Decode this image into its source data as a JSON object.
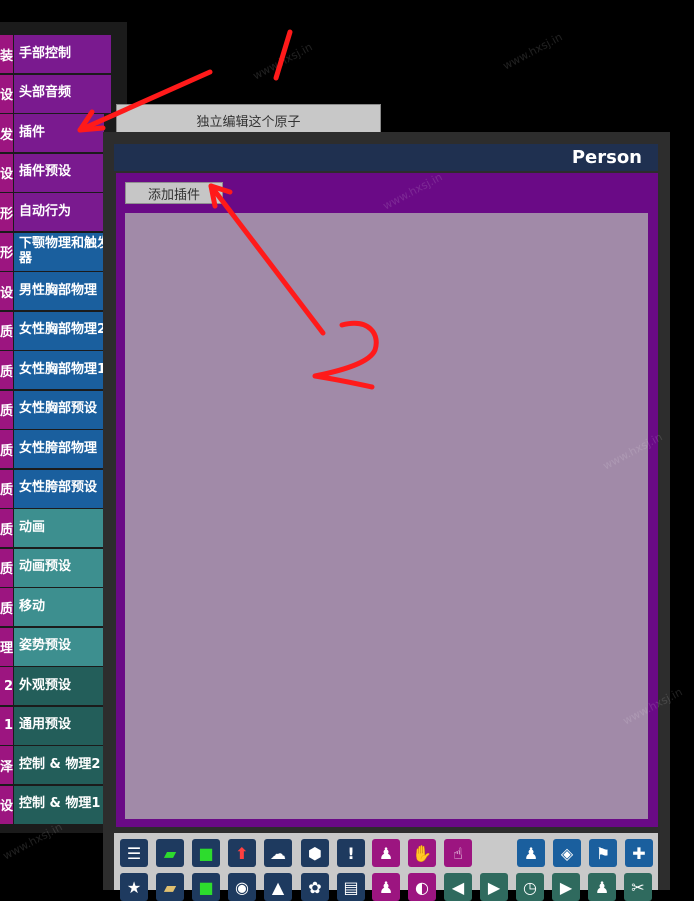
{
  "sidebar": {
    "tabs": [
      {
        "left": "装",
        "label": "手部控制",
        "left_color": "#9c1580",
        "color": "#7a1a8f"
      },
      {
        "left": "设",
        "label": "头部音频",
        "left_color": "#9c1580",
        "color": "#7a1a8f"
      },
      {
        "left": "发",
        "label": "插件",
        "left_color": "#9c1580",
        "color": "#7a1a8f",
        "active": true
      },
      {
        "left": "设",
        "label": "插件预设",
        "left_color": "#9c1580",
        "color": "#7a1a8f"
      },
      {
        "left": "形",
        "label": "自动行为",
        "left_color": "#9c1580",
        "color": "#7a1a8f"
      },
      {
        "left": "形",
        "label": "下颚物理和触发器",
        "left_color": "#9c1580",
        "color": "#1a5f9e"
      },
      {
        "left": "设",
        "label": "男性胸部物理",
        "left_color": "#9c1580",
        "color": "#1a5f9e"
      },
      {
        "left": "质",
        "label": "女性胸部物理2",
        "left_color": "#9c1580",
        "color": "#1a5f9e"
      },
      {
        "left": "质",
        "label": "女性胸部物理1",
        "left_color": "#9c1580",
        "color": "#1a5f9e"
      },
      {
        "left": "质",
        "label": "女性胸部预设",
        "left_color": "#9c1580",
        "color": "#1a5f9e"
      },
      {
        "left": "质",
        "label": "女性胯部物理",
        "left_color": "#9c1580",
        "color": "#1a5f9e"
      },
      {
        "left": "质",
        "label": "女性胯部预设",
        "left_color": "#9c1580",
        "color": "#1a5f9e"
      },
      {
        "left": "质",
        "label": "动画",
        "left_color": "#9c1580",
        "color": "#3d8f8f"
      },
      {
        "left": "质",
        "label": "动画预设",
        "left_color": "#9c1580",
        "color": "#3d8f8f"
      },
      {
        "left": "质",
        "label": "移动",
        "left_color": "#9c1580",
        "color": "#3d8f8f"
      },
      {
        "left": "理",
        "label": "姿势预设",
        "left_color": "#9c1580",
        "color": "#3d8f8f"
      },
      {
        "left": "2",
        "label": "外观预设",
        "left_color": "#9c1580",
        "color": "#235e5a"
      },
      {
        "left": "1",
        "label": "通用预设",
        "left_color": "#9c1580",
        "color": "#235e5a"
      },
      {
        "left": "泽",
        "label": "控制 & 物理2",
        "left_color": "#9c1580",
        "color": "#235e5a"
      },
      {
        "left": "设",
        "label": "控制 & 物理1",
        "left_color": "#9c1580",
        "color": "#235e5a"
      }
    ]
  },
  "tooltip": {
    "text": "独立编辑这个原子"
  },
  "panel": {
    "title": "Person",
    "add_plugin_label": "添加插件"
  },
  "annotations": {
    "label_1": "1",
    "label_2": "2",
    "color": "#ff1a1a"
  },
  "watermark": {
    "text": "www.hxsj.in"
  },
  "toolbar": {
    "row1": [
      {
        "icon": "menu-icon",
        "glyph": "☰",
        "bg": "#1e3a5f"
      },
      {
        "icon": "open-folder-icon",
        "glyph": "▰",
        "bg": "#1e3a5f",
        "color": "#2ddc2d"
      },
      {
        "icon": "folder-icon",
        "glyph": "■",
        "bg": "#1e3a5f",
        "color": "#2ddc2d"
      },
      {
        "icon": "export-icon",
        "glyph": "⬆",
        "bg": "#1e3a5f",
        "color": "#ff4040"
      },
      {
        "icon": "cloud-icon",
        "glyph": "☁",
        "bg": "#1e3a5f"
      },
      {
        "icon": "cube-icon",
        "glyph": "⬢",
        "bg": "#1e3a5f"
      },
      {
        "icon": "alert-icon",
        "glyph": "!",
        "bg": "#1e3a5f"
      },
      {
        "icon": "add-person-icon",
        "glyph": "♟",
        "bg": "#9c1580"
      },
      {
        "icon": "hand-icon",
        "glyph": "✋",
        "bg": "#9c1580"
      },
      {
        "icon": "pointer-icon",
        "glyph": "☝",
        "bg": "#9c1580"
      },
      {
        "icon": "person-icon",
        "glyph": "♟",
        "bg": "#1a5f9e"
      },
      {
        "icon": "unity-icon",
        "glyph": "◈",
        "bg": "#1a5f9e"
      },
      {
        "icon": "flag-icon",
        "glyph": "⚑",
        "bg": "#1a5f9e"
      },
      {
        "icon": "plus-icon",
        "glyph": "✚",
        "bg": "#1a5f9e"
      }
    ],
    "row2": [
      {
        "icon": "star-icon",
        "glyph": "★",
        "bg": "#1e3a5f"
      },
      {
        "icon": "folder-open-icon",
        "glyph": "▰",
        "bg": "#1e3a5f",
        "color": "#e0c070"
      },
      {
        "icon": "folder-add-icon",
        "glyph": "■",
        "bg": "#1e3a5f",
        "color": "#2ddc2d"
      },
      {
        "icon": "camera-icon",
        "glyph": "◉",
        "bg": "#1e3a5f"
      },
      {
        "icon": "scene-icon",
        "glyph": "▲",
        "bg": "#1e3a5f"
      },
      {
        "icon": "settings-icon",
        "glyph": "✿",
        "bg": "#1e3a5f"
      },
      {
        "icon": "document-icon",
        "glyph": "▤",
        "bg": "#1e3a5f"
      },
      {
        "icon": "person-select-icon",
        "glyph": "♟",
        "bg": "#9c1580"
      },
      {
        "icon": "rotate-icon",
        "glyph": "◐",
        "bg": "#9c1580"
      },
      {
        "icon": "step-back-icon",
        "glyph": "◀",
        "bg": "#2f6a5e"
      },
      {
        "icon": "play-icon",
        "glyph": "▶",
        "bg": "#2f6a5e"
      },
      {
        "icon": "clock-icon",
        "glyph": "◷",
        "bg": "#2f6a5e"
      },
      {
        "icon": "forward-icon",
        "glyph": "▶",
        "bg": "#2f6a5e"
      },
      {
        "icon": "people-icon",
        "glyph": "♟",
        "bg": "#2f6a5e"
      },
      {
        "icon": "tools-icon",
        "glyph": "✂",
        "bg": "#2f6a5e"
      }
    ]
  }
}
